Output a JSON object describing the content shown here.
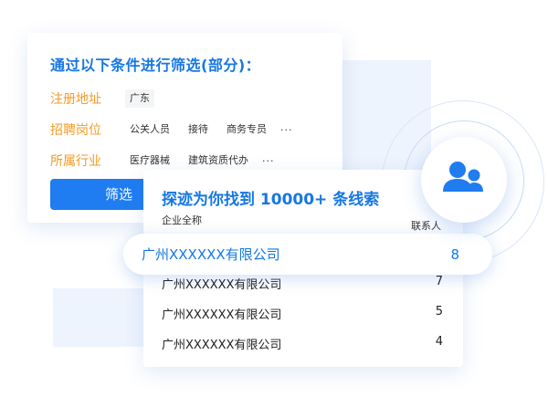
{
  "filter": {
    "title": "通过以下条件进行筛选(部分)：",
    "rows": [
      {
        "label": "注册地址",
        "tags": [
          "广东"
        ],
        "more": ""
      },
      {
        "label": "招聘岗位",
        "tags": [
          "公关人员",
          "接待",
          "商务专员"
        ],
        "more": "···"
      },
      {
        "label": "所属行业",
        "tags": [
          "医疗器械",
          "建筑资质代办"
        ],
        "more": "···"
      }
    ],
    "button": "筛选"
  },
  "results": {
    "headline": "探迹为你找到 10000+ 条线索",
    "col_company": "企业全称",
    "col_contact": "联系人",
    "highlight": {
      "company": "广州XXXXXX有限公司",
      "count": "8"
    },
    "rows": [
      {
        "company": "广州XXXXXX有限公司",
        "count": "7"
      },
      {
        "company": "广州XXXXXX有限公司",
        "count": "5"
      },
      {
        "company": "广州XXXXXX有限公司",
        "count": "4"
      }
    ]
  },
  "icons": {
    "users": "users-icon"
  },
  "colors": {
    "accent": "#1677e5",
    "label": "#f59a23",
    "button": "#1f7cf1"
  }
}
